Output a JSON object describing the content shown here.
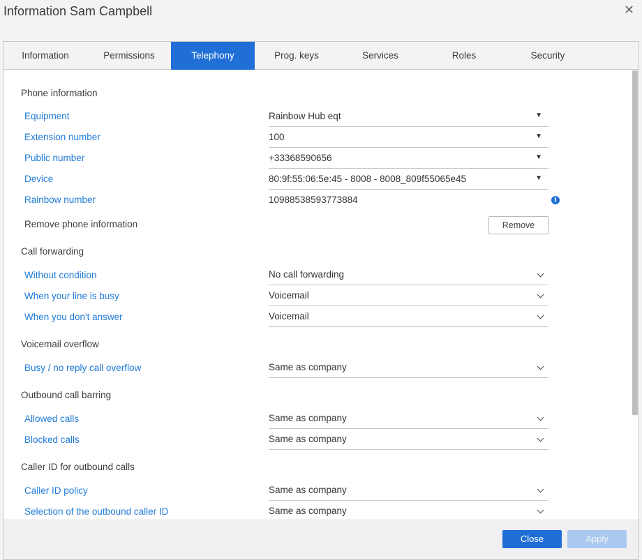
{
  "window": {
    "title": "Information Sam Campbell",
    "close_symbol": "✕"
  },
  "tabs": [
    {
      "label": "Information",
      "active": false
    },
    {
      "label": "Permissions",
      "active": false
    },
    {
      "label": "Telephony",
      "active": true
    },
    {
      "label": "Prog. keys",
      "active": false
    },
    {
      "label": "Services",
      "active": false
    },
    {
      "label": "Roles",
      "active": false
    },
    {
      "label": "Security",
      "active": false
    }
  ],
  "phone_information": {
    "heading": "Phone information",
    "equipment": {
      "label": "Equipment",
      "value": "Rainbow Hub eqt"
    },
    "extension": {
      "label": "Extension number",
      "value": "100"
    },
    "public_number": {
      "label": "Public number",
      "value": "+33368590656",
      "info_icon": "i"
    },
    "device": {
      "label": "Device",
      "value": "80:9f:55:06:5e:45 - 8008 - 8008_809f55065e45"
    },
    "rainbow_number": {
      "label": "Rainbow number",
      "value": "10988538593773884"
    },
    "remove": {
      "label": "Remove phone information",
      "button": "Remove"
    }
  },
  "call_forwarding": {
    "heading": "Call forwarding",
    "without_condition": {
      "label": "Without condition",
      "value": "No call forwarding"
    },
    "line_busy": {
      "label": "When your line is busy",
      "value": "Voicemail"
    },
    "no_answer": {
      "label": "When you don't answer",
      "value": "Voicemail"
    }
  },
  "voicemail_overflow": {
    "heading": "Voicemail overflow",
    "busy_no_reply": {
      "label": "Busy / no reply call overflow",
      "value": "Same as company"
    }
  },
  "outbound_barring": {
    "heading": "Outbound call barring",
    "allowed": {
      "label": "Allowed calls",
      "value": "Same as company"
    },
    "blocked": {
      "label": "Blocked calls",
      "value": "Same as company"
    }
  },
  "caller_id": {
    "heading": "Caller ID for outbound calls",
    "policy": {
      "label": "Caller ID policy",
      "value": "Same as company"
    },
    "selection": {
      "label": "Selection of the outbound caller ID",
      "value": "Same as company"
    }
  },
  "footer": {
    "close_label": "Close",
    "apply_label": "Apply"
  },
  "colors": {
    "accent": "#1f6fd6",
    "link": "#1f7ad6",
    "apply_disabled": "#a9c9f0"
  },
  "icons": {
    "dropdown_caret": "▼",
    "chevron": "chevron-down-icon",
    "info": "info-icon",
    "close": "close-icon"
  }
}
